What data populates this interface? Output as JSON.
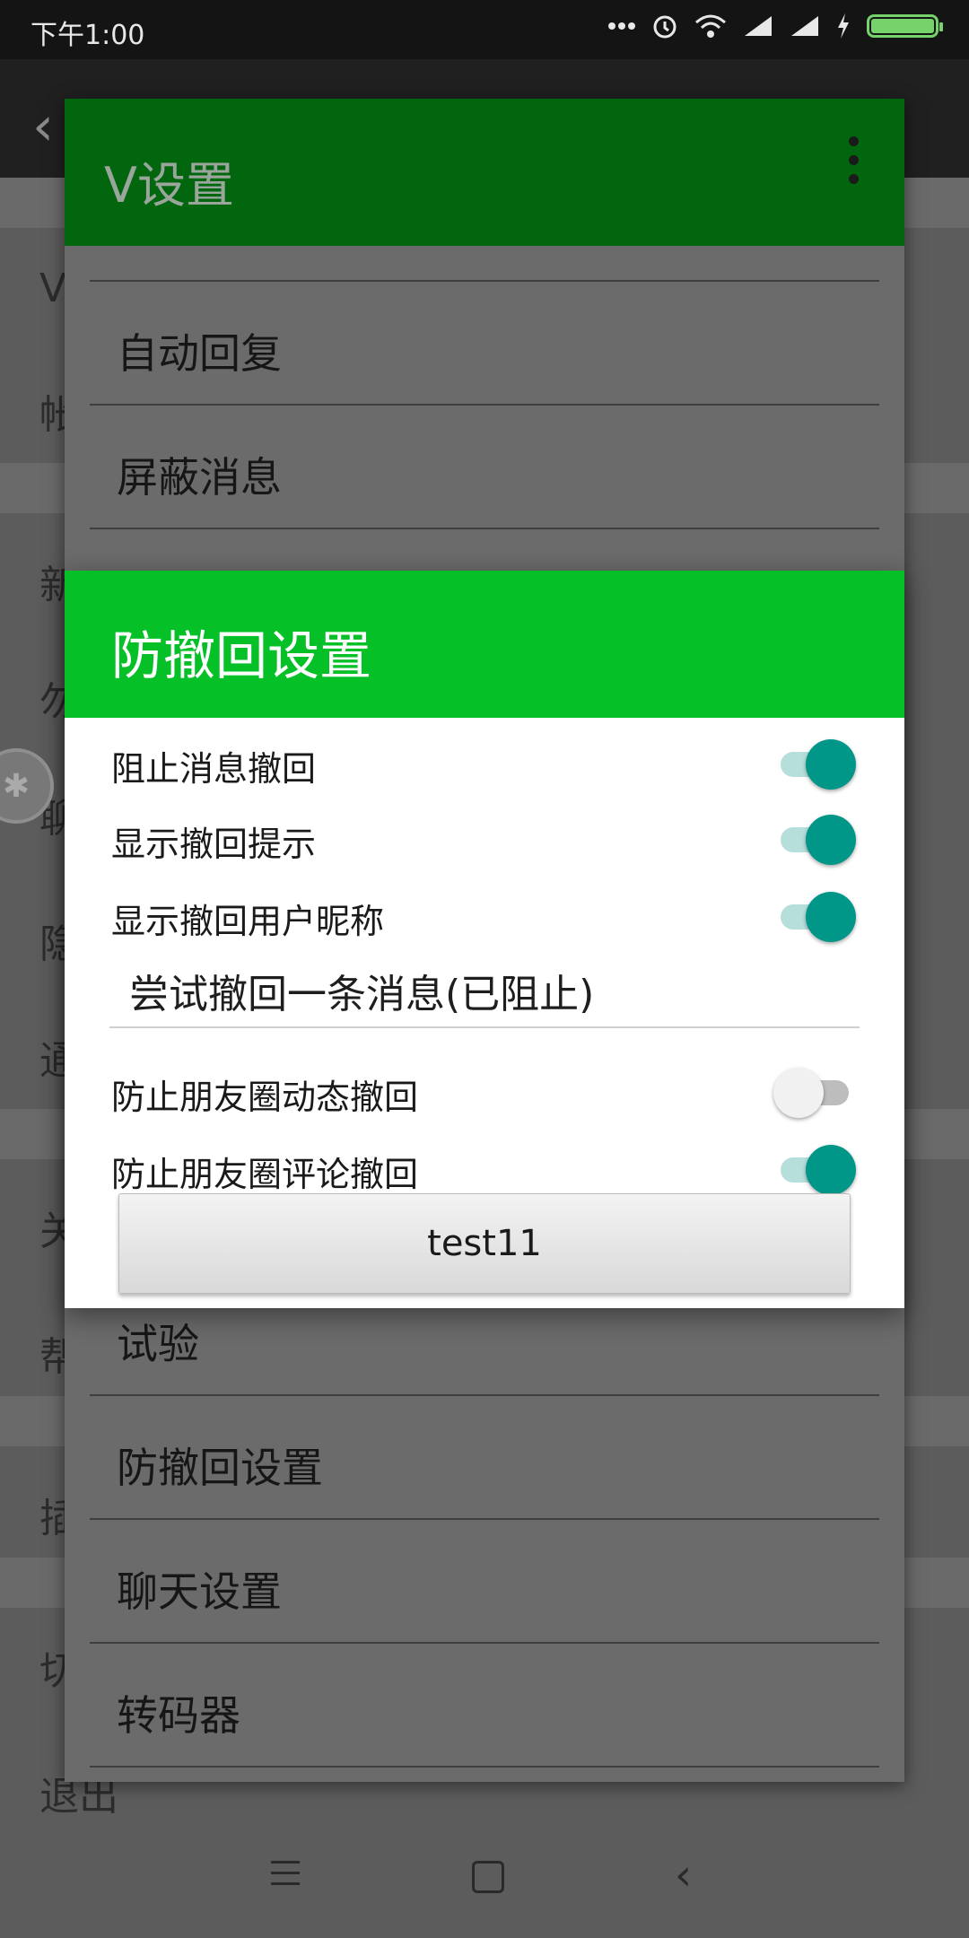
{
  "status_bar": {
    "time": "下午1:00",
    "icons": [
      "more-dots-icon",
      "alarm-icon",
      "wifi-icon",
      "signal-icon",
      "signal-icon",
      "charging-icon",
      "battery-icon"
    ],
    "battery_color": "#76d36b"
  },
  "background": {
    "row_letters": [
      "V",
      "帐",
      "新",
      "勿",
      "聊",
      "隐",
      "通",
      "关",
      "帮",
      "插",
      "切",
      "退出"
    ]
  },
  "v_panel": {
    "title": "V设置",
    "header_color": "#02660f",
    "items_top": [
      "自动回复",
      "屏蔽消息"
    ],
    "items_bottom": [
      "试验",
      "防撤回设置",
      "聊天设置",
      "转码器"
    ]
  },
  "dialog": {
    "title": "防撤回设置",
    "header_color": "#06c027",
    "switch_color": "#009688",
    "rows": [
      {
        "label": "阻止消息撤回",
        "on": true
      },
      {
        "label": "显示撤回提示",
        "on": true
      },
      {
        "label": "显示撤回用户昵称",
        "on": true
      }
    ],
    "test_message": "尝试撤回一条消息(已阻止)",
    "rows_after": [
      {
        "label": "防止朋友圈动态撤回",
        "on": false
      },
      {
        "label": "防止朋友圈评论撤回",
        "on": true
      }
    ],
    "button_label": "test11"
  },
  "navbar": {
    "icons": [
      "menu-icon",
      "home-icon",
      "back-icon"
    ]
  }
}
